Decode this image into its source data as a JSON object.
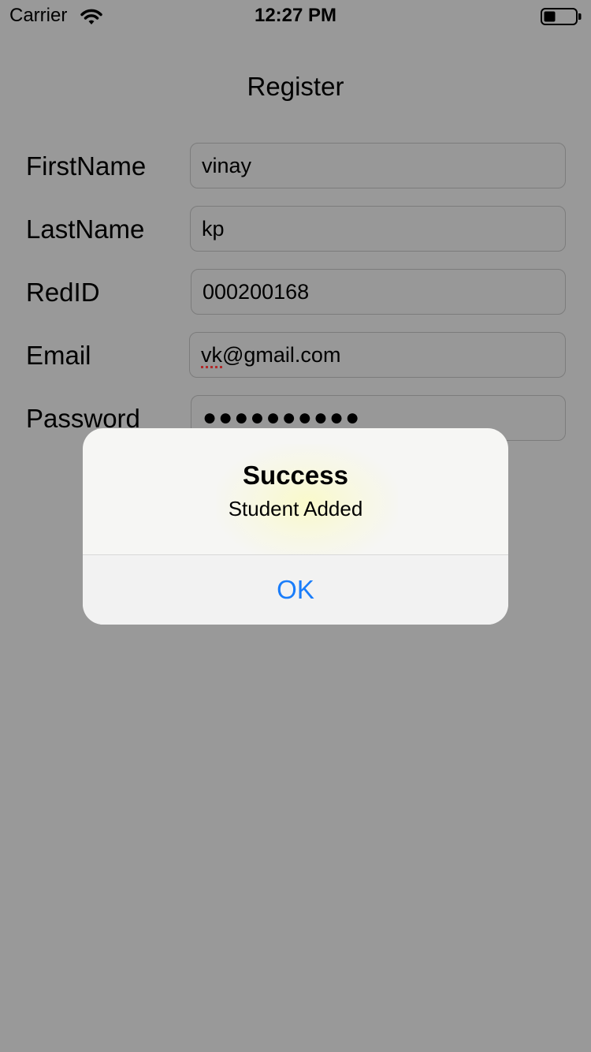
{
  "status_bar": {
    "carrier": "Carrier",
    "time": "12:27 PM",
    "wifi_icon": "wifi-icon",
    "battery_icon": "battery-icon"
  },
  "nav": {
    "title": "Register"
  },
  "form": {
    "first_name": {
      "label": "FirstName",
      "value": "vinay"
    },
    "last_name": {
      "label": "LastName",
      "value": "kp"
    },
    "red_id": {
      "label": "RedID",
      "value": "000200168"
    },
    "email": {
      "label": "Email",
      "value_misspelled": "vk",
      "value_rest": "@gmail.com"
    },
    "password": {
      "label": "Password",
      "value": "●●●●●●●●●●"
    }
  },
  "alert": {
    "title": "Success",
    "message": "Student Added",
    "button_label": "OK"
  },
  "colors": {
    "dimmed_background": "#999999",
    "alert_background": "#f6f6f4",
    "link_blue": "#1a7dfa"
  }
}
